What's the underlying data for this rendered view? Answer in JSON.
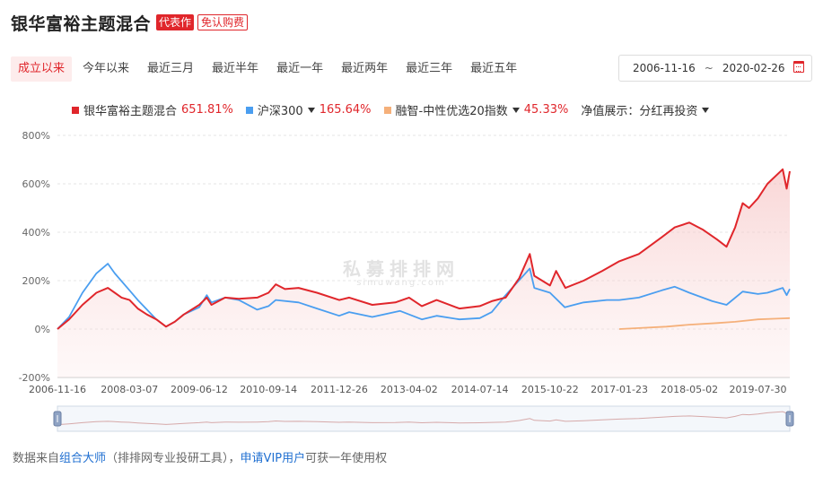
{
  "header": {
    "title": "银华富裕主题混合",
    "badge_rep": "代表作",
    "badge_free": "免认购费"
  },
  "tabs": [
    {
      "label": "成立以来",
      "active": true
    },
    {
      "label": "今年以来"
    },
    {
      "label": "最近三月"
    },
    {
      "label": "最近半年"
    },
    {
      "label": "最近一年"
    },
    {
      "label": "最近两年"
    },
    {
      "label": "最近三年"
    },
    {
      "label": "最近五年"
    }
  ],
  "date_range": {
    "start": "2006-11-16",
    "sep": "~",
    "end": "2020-02-26"
  },
  "legend": {
    "items": [
      {
        "name": "银华富裕主题混合",
        "value": "651.81%",
        "color": "#e0262b",
        "dropdown": false
      },
      {
        "name": "沪深300",
        "value": "165.64%",
        "color": "#4a9ef0",
        "dropdown": true
      },
      {
        "name": "融智-中性优选20指数",
        "value": "45.33%",
        "color": "#f5b07a",
        "dropdown": true
      }
    ],
    "nav_mode": "净值展示：分红再投资"
  },
  "watermark": {
    "cn": "私募排排网",
    "en": "simuwang.com"
  },
  "footer": {
    "prefix": "数据来自",
    "link1": "组合大师",
    "mid": "（排排网专业投研工具），",
    "link2": "申请VIP用户",
    "suffix": "可获一年使用权"
  },
  "chart_data": {
    "type": "line",
    "y_unit": "%",
    "ylim": [
      -200,
      800
    ],
    "yticks": [
      "800%",
      "600%",
      "400%",
      "200%",
      "0%",
      "-200%"
    ],
    "ytick_values": [
      800,
      600,
      400,
      200,
      0,
      -200
    ],
    "xticks": [
      "2006-11-16",
      "2008-03-07",
      "2009-06-12",
      "2010-09-14",
      "2011-12-26",
      "2013-04-02",
      "2014-07-14",
      "2015-10-22",
      "2017-01-23",
      "2018-05-02",
      "2019-07-30"
    ],
    "x_range": [
      "2006-11-16",
      "2020-02-26"
    ],
    "grid": "horizontal-dashed",
    "series": [
      {
        "name": "银华富裕主题混合",
        "color": "#e0262b",
        "fill": true,
        "points": [
          [
            "2006-11-16",
            0
          ],
          [
            "2007-02-01",
            40
          ],
          [
            "2007-05-01",
            100
          ],
          [
            "2007-08-01",
            150
          ],
          [
            "2007-10-16",
            170
          ],
          [
            "2008-01-15",
            130
          ],
          [
            "2008-03-07",
            120
          ],
          [
            "2008-05-01",
            85
          ],
          [
            "2008-07-01",
            60
          ],
          [
            "2008-09-01",
            40
          ],
          [
            "2008-11-04",
            10
          ],
          [
            "2009-01-01",
            30
          ],
          [
            "2009-03-01",
            60
          ],
          [
            "2009-06-12",
            100
          ],
          [
            "2009-08-01",
            130
          ],
          [
            "2009-09-01",
            100
          ],
          [
            "2009-12-01",
            130
          ],
          [
            "2010-03-01",
            125
          ],
          [
            "2010-07-01",
            130
          ],
          [
            "2010-09-14",
            150
          ],
          [
            "2010-11-01",
            185
          ],
          [
            "2011-01-01",
            165
          ],
          [
            "2011-04-01",
            170
          ],
          [
            "2011-08-01",
            150
          ],
          [
            "2011-12-26",
            120
          ],
          [
            "2012-03-01",
            130
          ],
          [
            "2012-08-01",
            100
          ],
          [
            "2013-01-01",
            110
          ],
          [
            "2013-04-02",
            130
          ],
          [
            "2013-06-25",
            95
          ],
          [
            "2013-10-01",
            120
          ],
          [
            "2014-03-01",
            85
          ],
          [
            "2014-07-14",
            95
          ],
          [
            "2014-10-01",
            115
          ],
          [
            "2015-01-01",
            130
          ],
          [
            "2015-04-01",
            210
          ],
          [
            "2015-06-10",
            310
          ],
          [
            "2015-07-10",
            220
          ],
          [
            "2015-10-22",
            180
          ],
          [
            "2015-12-01",
            240
          ],
          [
            "2016-02-01",
            170
          ],
          [
            "2016-06-01",
            200
          ],
          [
            "2016-10-01",
            240
          ],
          [
            "2017-01-23",
            280
          ],
          [
            "2017-06-01",
            310
          ],
          [
            "2017-11-01",
            380
          ],
          [
            "2018-01-25",
            420
          ],
          [
            "2018-05-02",
            440
          ],
          [
            "2018-08-01",
            410
          ],
          [
            "2018-11-01",
            370
          ],
          [
            "2019-01-03",
            340
          ],
          [
            "2019-03-01",
            420
          ],
          [
            "2019-04-20",
            520
          ],
          [
            "2019-06-01",
            500
          ],
          [
            "2019-07-30",
            540
          ],
          [
            "2019-10-01",
            600
          ],
          [
            "2020-01-10",
            660
          ],
          [
            "2020-02-05",
            580
          ],
          [
            "2020-02-26",
            651.81
          ]
        ]
      },
      {
        "name": "沪深300",
        "color": "#4a9ef0",
        "fill": false,
        "points": [
          [
            "2006-11-16",
            0
          ],
          [
            "2007-02-01",
            50
          ],
          [
            "2007-05-01",
            150
          ],
          [
            "2007-08-01",
            230
          ],
          [
            "2007-10-16",
            270
          ],
          [
            "2007-12-01",
            230
          ],
          [
            "2008-03-07",
            160
          ],
          [
            "2008-05-01",
            120
          ],
          [
            "2008-07-01",
            80
          ],
          [
            "2008-09-01",
            40
          ],
          [
            "2008-11-04",
            10
          ],
          [
            "2009-01-01",
            30
          ],
          [
            "2009-03-01",
            60
          ],
          [
            "2009-06-12",
            90
          ],
          [
            "2009-08-01",
            140
          ],
          [
            "2009-09-01",
            110
          ],
          [
            "2009-12-01",
            130
          ],
          [
            "2010-03-01",
            120
          ],
          [
            "2010-07-01",
            80
          ],
          [
            "2010-09-14",
            95
          ],
          [
            "2010-11-01",
            120
          ],
          [
            "2011-04-01",
            110
          ],
          [
            "2011-08-01",
            85
          ],
          [
            "2011-12-26",
            55
          ],
          [
            "2012-03-01",
            70
          ],
          [
            "2012-08-01",
            50
          ],
          [
            "2013-02-01",
            75
          ],
          [
            "2013-06-25",
            40
          ],
          [
            "2013-10-01",
            55
          ],
          [
            "2014-03-01",
            40
          ],
          [
            "2014-07-14",
            45
          ],
          [
            "2014-10-01",
            70
          ],
          [
            "2015-01-01",
            140
          ],
          [
            "2015-06-10",
            250
          ],
          [
            "2015-07-10",
            170
          ],
          [
            "2015-10-22",
            150
          ],
          [
            "2016-01-28",
            90
          ],
          [
            "2016-06-01",
            110
          ],
          [
            "2016-11-01",
            120
          ],
          [
            "2017-01-23",
            120
          ],
          [
            "2017-06-01",
            130
          ],
          [
            "2017-11-01",
            160
          ],
          [
            "2018-01-25",
            175
          ],
          [
            "2018-05-02",
            150
          ],
          [
            "2018-10-01",
            115
          ],
          [
            "2019-01-03",
            100
          ],
          [
            "2019-04-20",
            155
          ],
          [
            "2019-07-30",
            145
          ],
          [
            "2019-10-01",
            150
          ],
          [
            "2020-01-10",
            170
          ],
          [
            "2020-02-05",
            140
          ],
          [
            "2020-02-26",
            165.64
          ]
        ]
      },
      {
        "name": "融智-中性优选20指数",
        "color": "#f5b07a",
        "fill": false,
        "points": [
          [
            "2017-01-23",
            0
          ],
          [
            "2017-06-01",
            4
          ],
          [
            "2017-12-01",
            10
          ],
          [
            "2018-05-02",
            18
          ],
          [
            "2018-11-01",
            25
          ],
          [
            "2019-03-01",
            30
          ],
          [
            "2019-07-30",
            40
          ],
          [
            "2019-12-01",
            43
          ],
          [
            "2020-02-26",
            45.33
          ]
        ]
      }
    ]
  }
}
